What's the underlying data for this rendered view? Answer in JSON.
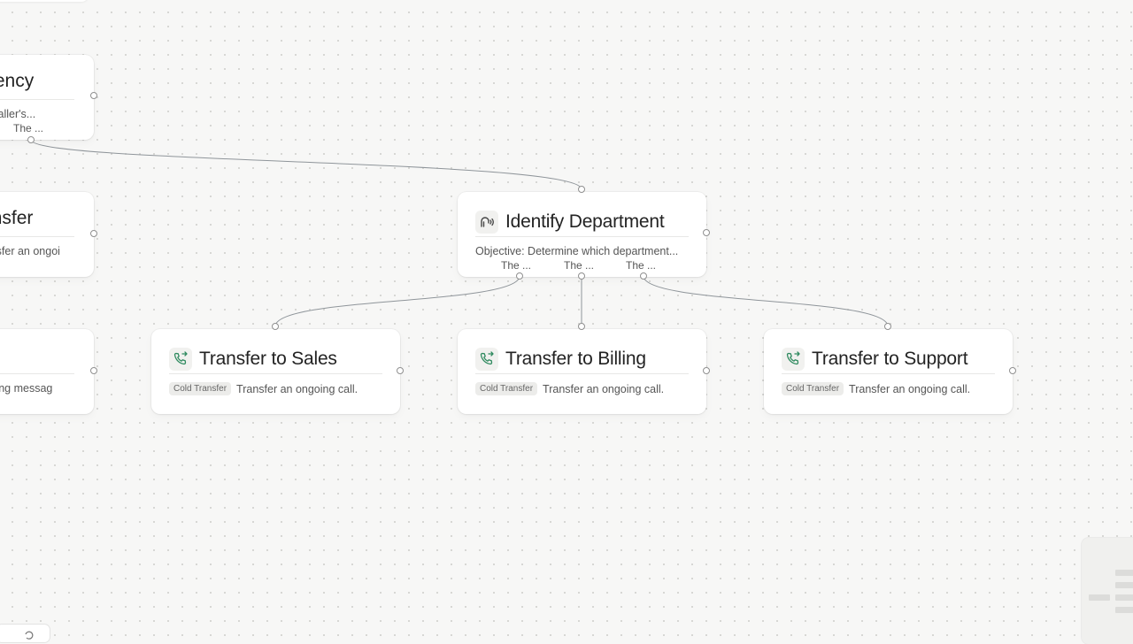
{
  "canvas": {
    "nodes": {
      "urgency_partial": {
        "title": "Urgency",
        "description": "...the caller's...",
        "edge_label": "The ..."
      },
      "transfer_partial": {
        "title": "Transfer",
        "description": "Transfer an ongoi...",
        "description_line2": "..."
      },
      "message_partial": {
        "title": "",
        "description": "Closing messag..."
      },
      "identify_department": {
        "title": "Identify Department",
        "description": "Objective: Determine which department...",
        "edge_labels": [
          "The ...",
          "The ...",
          "The ..."
        ],
        "icon": "voice-agent-icon"
      },
      "transfer_sales": {
        "title": "Transfer to Sales",
        "tag": "Cold Transfer",
        "description": "Transfer an ongoing call.",
        "icon": "phone-transfer-icon"
      },
      "transfer_billing": {
        "title": "Transfer to Billing",
        "tag": "Cold Transfer",
        "description": "Transfer an ongoing call.",
        "icon": "phone-transfer-icon"
      },
      "transfer_support": {
        "title": "Transfer to Support",
        "tag": "Cold Transfer",
        "description": "Transfer an ongoing call.",
        "icon": "phone-transfer-icon"
      }
    },
    "colors": {
      "background": "#f7f7f6",
      "edge": "#8f959a",
      "transfer_icon": "#2f8a5f"
    }
  }
}
